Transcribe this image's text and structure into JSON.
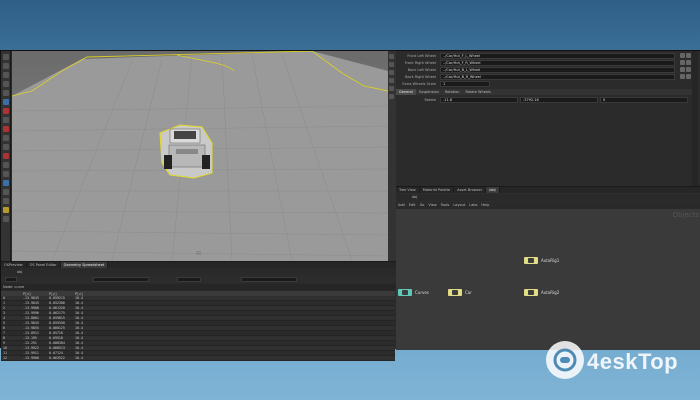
{
  "properties": {
    "rows": [
      {
        "label": "Front Left Wheel",
        "value": "../Car/Hut_F_L_Wheel"
      },
      {
        "label": "Front Right Wheel",
        "value": "../Car/Hut_F_R_Wheel"
      },
      {
        "label": "Back Left Wheel",
        "value": "../Car/Hut_B_L_Wheel"
      },
      {
        "label": "Back Right Wheel",
        "value": "../Car/Hut_B_R_Wheel"
      }
    ],
    "wheel_scale_label": "Extra Wheels Scale",
    "wheel_scale_value": "1",
    "tabs": [
      "General",
      "Suspension",
      "Rotation",
      "Rotate Wheels"
    ],
    "rotation_label": "Rotate",
    "rotation_values": [
      "-11.6",
      "-3792.16",
      "0"
    ]
  },
  "node_editor": {
    "tabs": [
      "Tree View",
      "Material Palette",
      "Asset Browser",
      "/obj"
    ],
    "path": "obj",
    "menu": [
      "Add",
      "Edit",
      "Go",
      "View",
      "Tools",
      "Layout",
      "Labs",
      "Help"
    ],
    "watermark": "Objects",
    "nodes": [
      {
        "name": "AutoRig1",
        "color": "#e3dc86"
      },
      {
        "name": "Curves",
        "color": "#5fc9b9"
      },
      {
        "name": "Car",
        "color": "#e3dc86"
      },
      {
        "name": "AutoRig2",
        "color": "#e3dc86"
      }
    ]
  },
  "bottom": {
    "tabs": [
      "OSPreview",
      "OS Panel Editor",
      "Geometry Spreadsheet"
    ],
    "path": "obj",
    "node_label": "Node: curve",
    "columns": [
      "",
      "P[x]",
      "P[y]",
      "P[z]"
    ],
    "rows": [
      [
        "0",
        "-13.9845",
        "0.059215",
        "10.4"
      ],
      [
        "1",
        "-13.9845",
        "0.052306",
        "10.4"
      ],
      [
        "2",
        "-13.9900",
        "0.061320",
        "10.4"
      ],
      [
        "3",
        "-13.9996",
        "0.062175",
        "10.4"
      ],
      [
        "4",
        "-13.8001",
        "0.059815",
        "10.4"
      ],
      [
        "5",
        "-13.9845",
        "0.059350",
        "10.4"
      ],
      [
        "6",
        "-13.9855",
        "0.060125",
        "10.4"
      ],
      [
        "7",
        "-13.0911",
        "0.05718",
        "10.4"
      ],
      [
        "8",
        "-13.195",
        "0.09518",
        "10.4"
      ],
      [
        "9",
        "-13.291",
        "0.080304",
        "10.4"
      ],
      [
        "10",
        "-13.9922",
        "0.068513",
        "10.4"
      ],
      [
        "11",
        "-13.9911",
        "0.07124",
        "10.4"
      ],
      [
        "12",
        "-13.9900",
        "0.063522",
        "10.4"
      ]
    ]
  },
  "watermark": {
    "text": "4eskTop"
  }
}
